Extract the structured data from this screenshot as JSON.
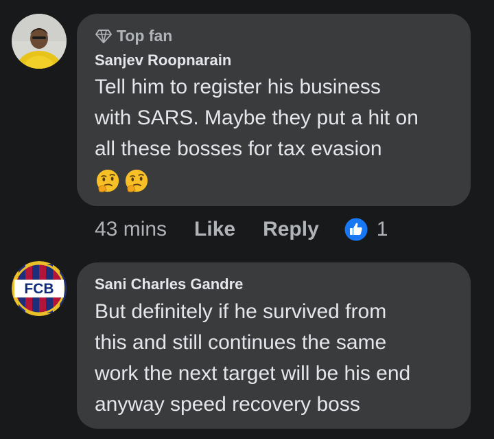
{
  "comments": [
    {
      "badge": "Top fan",
      "author": "Sanjev Roopnarain",
      "lines": [
        "Tell him to register his business",
        "with SARS. Maybe they put a hit on",
        "all these bosses for tax evasion"
      ],
      "emoji_icons": [
        "thinking-face-icon",
        "thinking-face-icon"
      ],
      "time": "43 mins",
      "like_label": "Like",
      "reply_label": "Reply",
      "reaction_count": "1"
    },
    {
      "author": "Sani Charles Gandre",
      "avatar_text": "FCB",
      "lines": [
        "But definitely if he survived from",
        "this and still continues the same",
        "work the next target will be his end",
        "anyway speed recovery boss"
      ]
    }
  ],
  "colors": {
    "background": "#18191a",
    "bubble": "#3a3b3c",
    "primary_text": "#e4e6eb",
    "secondary_text": "#b0b3b8",
    "like_blue": "#1877f2"
  }
}
